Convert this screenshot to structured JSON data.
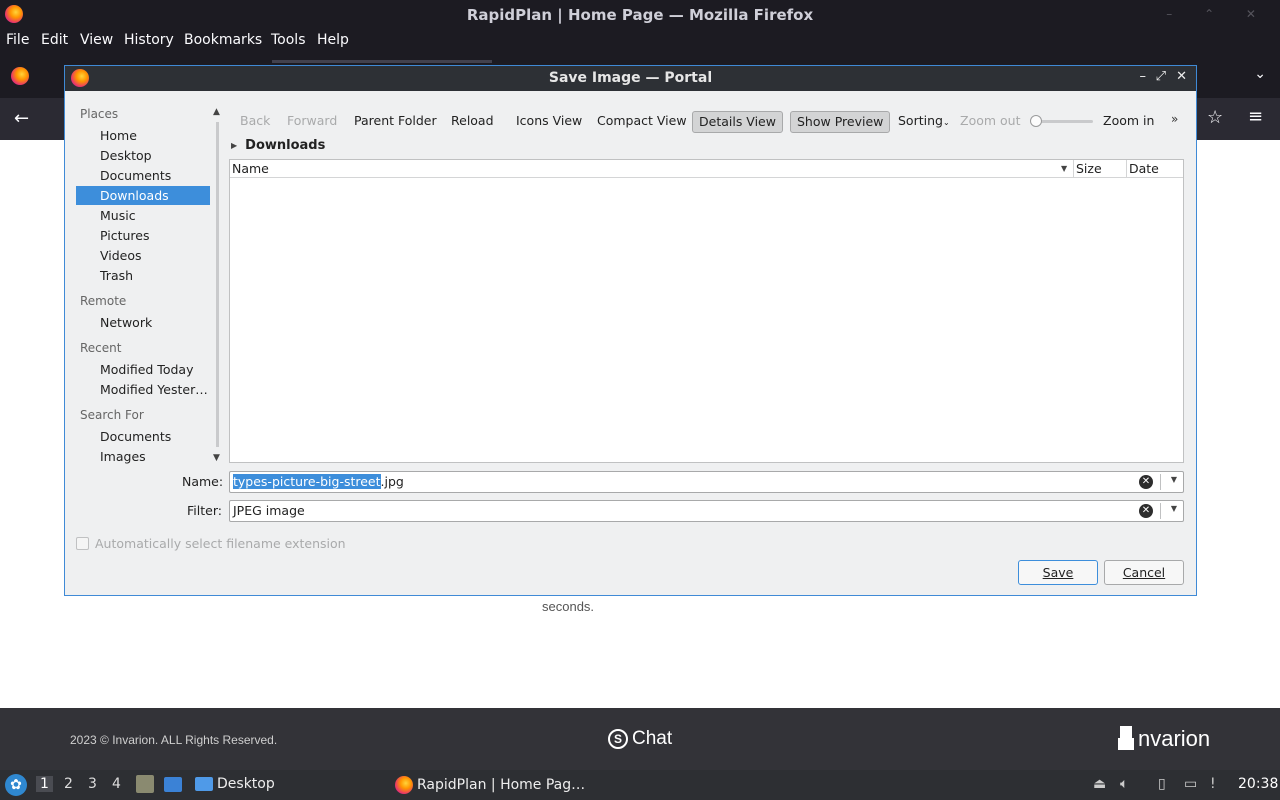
{
  "browser": {
    "window_title": "RapidPlan | Home Page — Mozilla Firefox",
    "menu": [
      "File",
      "Edit",
      "View",
      "History",
      "Bookmarks",
      "Tools",
      "Help"
    ]
  },
  "page": {
    "seconds_text": "seconds.",
    "footer": {
      "copyright": "2023 © Invarion. ALL Rights Reserved.",
      "chat_label": "Chat",
      "brand": "nvarion"
    }
  },
  "dialog": {
    "title": "Save Image — Portal",
    "places": {
      "headings": {
        "places": "Places",
        "remote": "Remote",
        "recent": "Recent",
        "search": "Search For"
      },
      "items": {
        "home": "Home",
        "desktop": "Desktop",
        "documents": "Documents",
        "downloads": "Downloads",
        "music": "Music",
        "pictures": "Pictures",
        "videos": "Videos",
        "trash": "Trash",
        "network": "Network",
        "modified_today": "Modified Today",
        "modified_yesterday": "Modified Yester…",
        "search_documents": "Documents",
        "search_images": "Images"
      },
      "selected": "Downloads"
    },
    "toolbar": {
      "back": "Back",
      "forward": "Forward",
      "parent": "Parent Folder",
      "reload": "Reload",
      "icons_view": "Icons View",
      "compact_view": "Compact View",
      "details_view": "Details View",
      "show_preview": "Show Preview",
      "sorting": "Sorting",
      "zoom_out": "Zoom out",
      "zoom_in": "Zoom in",
      "zoom_level": 0
    },
    "breadcrumb": "Downloads",
    "columns": [
      "Name",
      "Size",
      "Date"
    ],
    "name_label": "Name:",
    "name_value_selected": "types-picture-big-street",
    "name_value_rest": ".jpg",
    "filter_label": "Filter:",
    "filter_value": "JPEG image",
    "auto_extension_label": "Automatically select filename extension",
    "auto_extension_checked": false,
    "save_label": "Save",
    "cancel_label": "Cancel"
  },
  "taskbar": {
    "workspaces": [
      "1",
      "2",
      "3",
      "4"
    ],
    "active_workspace": "1",
    "desktop_label": "Desktop",
    "firefox_task": "RapidPlan | Home Pag…",
    "clock": "20:38"
  }
}
